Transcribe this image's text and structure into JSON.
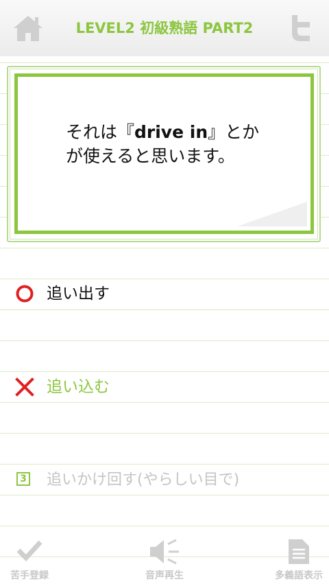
{
  "header": {
    "title": "LEVEL2 初級熟語 PART2",
    "home_icon": "home-icon",
    "share_icon": "twitter-icon"
  },
  "question": {
    "prefix": "それは『",
    "highlight": "drive in",
    "suffix": "』とかが使えると思います。"
  },
  "choices": [
    {
      "label": "追い出す",
      "mark": "circle-icon",
      "state": "correct"
    },
    {
      "label": "追い込む",
      "mark": "cross-icon",
      "state": "selected-wrong"
    },
    {
      "label": "追いかけ回す(やらしい目で)",
      "mark": "3",
      "state": "disabled"
    }
  ],
  "toolbar": {
    "items": [
      {
        "label": "苦手登録",
        "icon": "checkmark-icon"
      },
      {
        "label": "音声再生",
        "icon": "speaker-icon"
      },
      {
        "label": "多義語表示",
        "icon": "document-icon"
      }
    ]
  },
  "colors": {
    "accent": "#8cc63f",
    "correct": "#e02020",
    "disabled": "#c4c4c4"
  }
}
